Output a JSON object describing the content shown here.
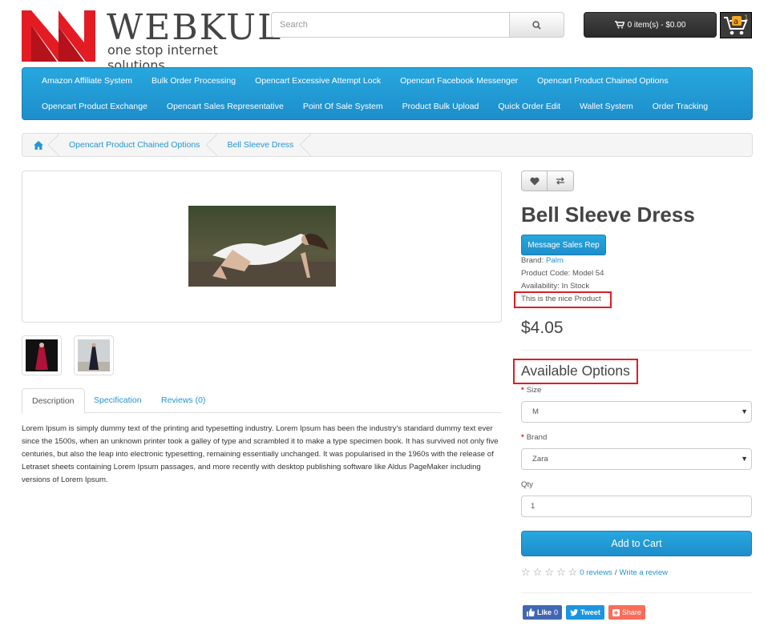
{
  "header": {
    "logo_brand": "WEBKUL",
    "logo_tagline": "one stop internet solutions",
    "search_placeholder": "Search",
    "cart_label": "0 item(s) - $0.00"
  },
  "menu": {
    "row1": [
      "Amazon Affiliate System",
      "Bulk Order Processing",
      "Opencart Excessive Attempt Lock",
      "Opencart Facebook Messenger",
      "Opencart Product Chained Options"
    ],
    "row2": [
      "Opencart Product Exchange",
      "Opencart Sales Representative",
      "Point Of Sale System",
      "Product Bulk Upload",
      "Quick Order Edit",
      "Wallet System",
      "Order Tracking"
    ]
  },
  "breadcrumb": {
    "items": [
      "Opencart Product Chained Options",
      "Bell Sleeve Dress"
    ]
  },
  "tabs": [
    "Description",
    "Specification",
    "Reviews (0)"
  ],
  "description": "Lorem Ipsum is simply dummy text of the printing and typesetting industry. Lorem Ipsum has been the industry's standard dummy text ever since the 1500s, when an unknown printer took a galley of type and scrambled it to make a type specimen book. It has survived not only five centuries, but also the leap into electronic typesetting, remaining essentially unchanged. It was popularised in the 1960s with the release of Letraset sheets containing Lorem Ipsum passages, and more recently with desktop publishing software like Aldus PageMaker including versions of Lorem Ipsum.",
  "product": {
    "title": "Bell Sleeve Dress",
    "message_button": "Message Sales Rep",
    "brand_label": "Brand:",
    "brand_value": "Palm",
    "code": "Product Code: Model 54",
    "availability": "Availability: In Stock",
    "note": "This is the nice Product",
    "price": "$4.05"
  },
  "options": {
    "heading": "Available Options",
    "size_label": "Size",
    "size_value": "M",
    "brand_label": "Brand",
    "brand_value": "Zara",
    "qty_label": "Qty",
    "qty_value": "1"
  },
  "actions": {
    "add_to_cart": "Add to Cart",
    "reviews_link": "0 reviews",
    "separator": "/",
    "write_review": "Write a review"
  },
  "social": {
    "like": "Like",
    "like_count": "0",
    "tweet": "Tweet",
    "share": "Share"
  },
  "colors": {
    "accent": "#229ac8",
    "highlight_box": "#e31b23",
    "logo_red": "#e31b23"
  }
}
